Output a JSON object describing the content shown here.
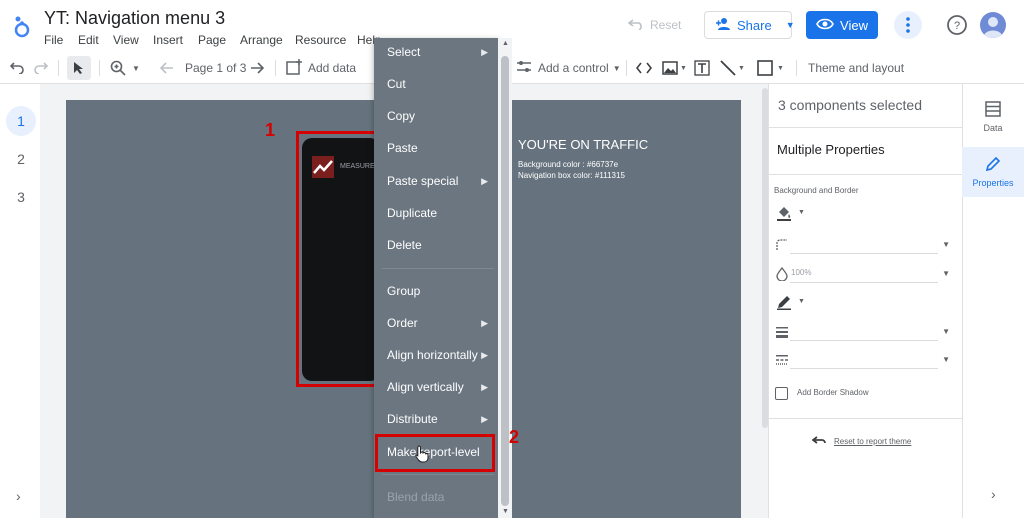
{
  "header": {
    "title": "YT: Navigation menu 3",
    "menus": [
      "File",
      "Edit",
      "View",
      "Insert",
      "Page",
      "Arrange",
      "Resource",
      "Help"
    ],
    "reset_label": "Reset",
    "share_label": "Share",
    "view_label": "View"
  },
  "toolbar": {
    "page_indicator": "Page 1 of 3",
    "add_data_label": "Add data",
    "add_control_label": "Add a control",
    "theme_label": "Theme and layout"
  },
  "pages": [
    "1",
    "2",
    "3"
  ],
  "canvas": {
    "brand_text": "MEASURE",
    "text_title": "YOU'RE ON TRAFFIC",
    "text_line1": "Background color : #66737e",
    "text_line2": "Navigation box color: #111315",
    "step1": "1",
    "step2": "2"
  },
  "context_menu": {
    "items": [
      {
        "label": "Select",
        "submenu": true
      },
      {
        "label": "Cut"
      },
      {
        "label": "Copy"
      },
      {
        "label": "Paste"
      },
      {
        "label": "Paste special",
        "submenu": true
      },
      {
        "label": "Duplicate"
      },
      {
        "label": "Delete"
      },
      {
        "label": "Group"
      },
      {
        "label": "Order",
        "submenu": true
      },
      {
        "label": "Align horizontally",
        "submenu": true
      },
      {
        "label": "Align vertically",
        "submenu": true
      },
      {
        "label": "Distribute",
        "submenu": true
      },
      {
        "label": "Make report-level"
      },
      {
        "label": "Blend data",
        "disabled": true
      }
    ]
  },
  "properties": {
    "components_selected": "3 components selected",
    "panel_title": "Multiple Properties",
    "section_label": "Background and Border",
    "opacity_value": "100%",
    "shadow_label": "Add Border Shadow",
    "reset_theme_label": "Reset to report theme"
  },
  "right_tabs": {
    "data_label": "Data",
    "properties_label": "Properties"
  },
  "colors": {
    "canvas_bg": "#66737e",
    "nav_box": "#111315",
    "accent": "#1a73e8",
    "highlight": "#d50000",
    "menu_bg": "#6b7680"
  }
}
